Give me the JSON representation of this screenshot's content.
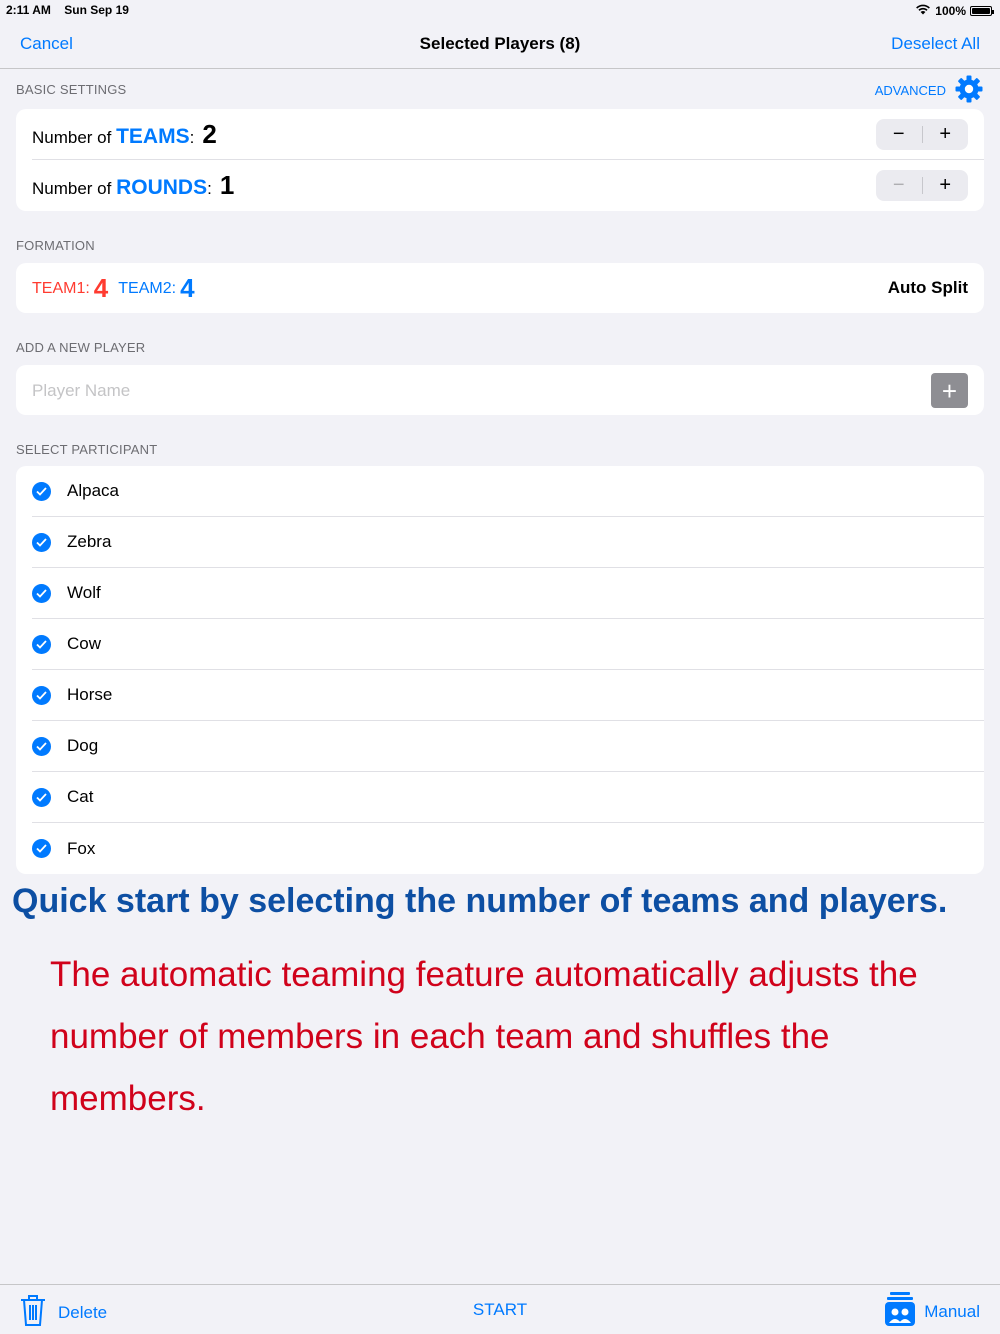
{
  "status_bar": {
    "time": "2:11 AM",
    "date": "Sun Sep 19",
    "battery": "100%"
  },
  "nav": {
    "cancel": "Cancel",
    "title": "Selected Players (8)",
    "deselect_all": "Deselect All"
  },
  "basic_settings": {
    "header": "BASIC SETTINGS",
    "advanced": "ADVANCED",
    "teams": {
      "prefix": "Number of ",
      "keyword": "TEAMS",
      "colon": ":",
      "value": "2"
    },
    "rounds": {
      "prefix": "Number of ",
      "keyword": "ROUNDS",
      "colon": ":",
      "value": "1"
    },
    "minus": "−",
    "plus": "+"
  },
  "formation": {
    "header": "FORMATION",
    "team1_label": "TEAM1:",
    "team1_count": "4",
    "team2_label": "TEAM2:",
    "team2_count": "4",
    "auto_split": "Auto Split"
  },
  "add_player": {
    "header": "ADD A NEW PLAYER",
    "placeholder": "Player Name",
    "add": "+"
  },
  "participants": {
    "header": "SELECT PARTICIPANT",
    "items": [
      "Alpaca",
      "Zebra",
      "Wolf",
      "Cow",
      "Horse",
      "Dog",
      "Cat",
      "Fox"
    ]
  },
  "promo": {
    "title": "Quick start by selecting the number of teams and players.",
    "body": "The automatic teaming feature automatically adjusts the number of members in each team and shuffles the members."
  },
  "toolbar": {
    "delete": "Delete",
    "start": "START",
    "manual": "Manual"
  },
  "colors": {
    "accent": "#007aff",
    "team1": "#ff3b30",
    "promo_title": "#0d4fa3",
    "promo_body": "#d0021b"
  }
}
